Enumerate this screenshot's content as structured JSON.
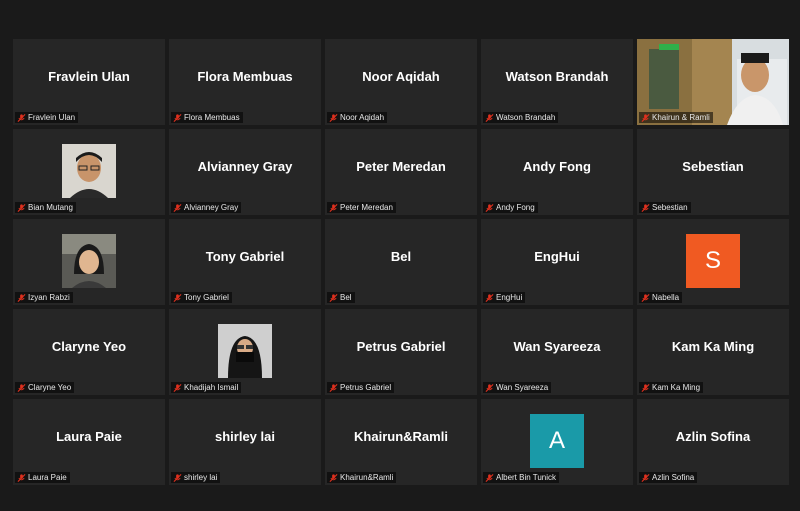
{
  "participants": [
    {
      "display": "Fravlein Ulan",
      "label": "Fravlein Ulan"
    },
    {
      "display": "Flora Membuas",
      "label": "Flora Membuas"
    },
    {
      "display": "Noor Aqidah",
      "label": "Noor Aqidah"
    },
    {
      "display": "Watson Brandah",
      "label": "Watson Brandah"
    },
    {
      "display": "",
      "label": "Khairun & Ramli"
    },
    {
      "display": "",
      "label": "Bian Mutang"
    },
    {
      "display": "Alvianney Gray",
      "label": "Alvianney Gray"
    },
    {
      "display": "Peter Meredan",
      "label": "Peter Meredan"
    },
    {
      "display": "Andy Fong",
      "label": "Andy Fong"
    },
    {
      "display": "Sebestian",
      "label": "Sebestian"
    },
    {
      "display": "",
      "label": "Izyan Rabzi"
    },
    {
      "display": "Tony Gabriel",
      "label": "Tony Gabriel"
    },
    {
      "display": "Bel",
      "label": "Bel"
    },
    {
      "display": "EngHui",
      "label": "EngHui"
    },
    {
      "display": "S",
      "label": "Nabella",
      "avatar_color": "#f05a22"
    },
    {
      "display": "Claryne Yeo",
      "label": "Claryne Yeo"
    },
    {
      "display": "",
      "label": "Khadijah Ismail"
    },
    {
      "display": "Petrus Gabriel",
      "label": "Petrus Gabriel"
    },
    {
      "display": "Wan Syareeza",
      "label": "Wan Syareeza"
    },
    {
      "display": "Kam Ka Ming",
      "label": "Kam Ka Ming"
    },
    {
      "display": "Laura Paie",
      "label": "Laura Paie"
    },
    {
      "display": "shirley lai",
      "label": "shirley lai"
    },
    {
      "display": "Khairun&Ramli",
      "label": "Khairun&Ramli"
    },
    {
      "display": "A",
      "label": "Albert Bin Tunick",
      "avatar_color": "#1a9aa8"
    },
    {
      "display": "Azlin Sofina",
      "label": "Azlin Sofina"
    }
  ],
  "icons": {
    "muted": "mic-muted-icon"
  },
  "colors": {
    "background": "#1a1a1a",
    "tile": "#262626",
    "muted_icon": "#e0301e"
  }
}
